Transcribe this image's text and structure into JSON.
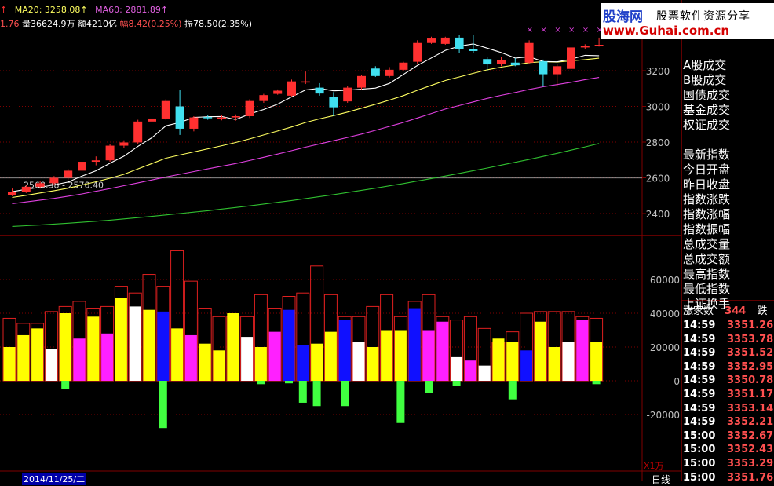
{
  "header": {
    "ma20_label": "MA20: 3258.08↑",
    "ma60_label": "MA60: 2881.89↑",
    "stat_partial": "1.76",
    "volume": "量36624.9万",
    "amount": "额4210亿",
    "change_pct": "幅8.42(0.25%)",
    "amplitude": "振78.50(2.35%)"
  },
  "logo": {
    "name": "股海网",
    "slogan": "股票软件资源分享",
    "url": "www.Guhai.com.cn"
  },
  "price_axis": {
    "labels": [
      "3200",
      "3000",
      "2800",
      "2600",
      "2400"
    ],
    "values": [
      3200,
      3000,
      2800,
      2600,
      2400
    ]
  },
  "volume_axis": {
    "labels": [
      "60000",
      "40000",
      "20000",
      "0",
      "-20000"
    ],
    "values": [
      60000,
      40000,
      20000,
      0,
      -20000
    ]
  },
  "low_marker": {
    "text": "2568.38 - 2570.40",
    "value": 2568.38
  },
  "sidebar": {
    "items_group1": [
      "A股成交",
      "B股成交",
      "国债成交",
      "基金成交",
      "权证成交"
    ],
    "items_group2": [
      "最新指数",
      "今日开盘",
      "昨日收盘",
      "指数涨跌",
      "指数涨幅",
      "指数振幅",
      "总成交量",
      "总成交额",
      "最高指数",
      "最低指数",
      "上证换手"
    ]
  },
  "stats": {
    "rise_label": "涨家数",
    "rise_count": "344",
    "fall_label": "跌"
  },
  "ticks": [
    {
      "time": "14:59",
      "price": "3351.26"
    },
    {
      "time": "14:59",
      "price": "3353.78"
    },
    {
      "time": "14:59",
      "price": "3351.52"
    },
    {
      "time": "14:59",
      "price": "3352.95"
    },
    {
      "time": "14:59",
      "price": "3350.78"
    },
    {
      "time": "14:59",
      "price": "3351.17"
    },
    {
      "time": "14:59",
      "price": "3353.14"
    },
    {
      "time": "14:59",
      "price": "3352.21"
    },
    {
      "time": "15:00",
      "price": "3352.67"
    },
    {
      "time": "15:00",
      "price": "3352.43"
    },
    {
      "time": "15:00",
      "price": "3353.29"
    },
    {
      "time": "15:00",
      "price": "3351.76"
    }
  ],
  "footer": {
    "scale": "X1万",
    "date": "2014/11/25/二",
    "period": "日线"
  },
  "colors": {
    "up": "#ff3030",
    "down": "#40e0f0",
    "ma20": "#ffff60",
    "ma60": "#e040e0",
    "ma120": "#30c030",
    "grid": "#800000"
  },
  "chart_data": {
    "type": "candlestick",
    "candles": [
      {
        "o": 2505,
        "h": 2540,
        "l": 2498,
        "c": 2522
      },
      {
        "o": 2522,
        "h": 2560,
        "l": 2515,
        "c": 2550
      },
      {
        "o": 2550,
        "h": 2580,
        "l": 2540,
        "c": 2570
      },
      {
        "o": 2570,
        "h": 2610,
        "l": 2560,
        "c": 2600
      },
      {
        "o": 2600,
        "h": 2650,
        "l": 2590,
        "c": 2640
      },
      {
        "o": 2640,
        "h": 2700,
        "l": 2625,
        "c": 2690
      },
      {
        "o": 2690,
        "h": 2720,
        "l": 2670,
        "c": 2698
      },
      {
        "o": 2698,
        "h": 2790,
        "l": 2690,
        "c": 2780
      },
      {
        "o": 2780,
        "h": 2810,
        "l": 2765,
        "c": 2798
      },
      {
        "o": 2798,
        "h": 2925,
        "l": 2790,
        "c": 2915
      },
      {
        "o": 2915,
        "h": 2950,
        "l": 2880,
        "c": 2932
      },
      {
        "o": 2932,
        "h": 3040,
        "l": 2925,
        "c": 3030
      },
      {
        "o": 3000,
        "h": 3090,
        "l": 2840,
        "c": 2875
      },
      {
        "o": 2875,
        "h": 2945,
        "l": 2860,
        "c": 2938
      },
      {
        "o": 2940,
        "h": 2950,
        "l": 2925,
        "c": 2935
      },
      {
        "o": 2935,
        "h": 2950,
        "l": 2922,
        "c": 2938
      },
      {
        "o": 2938,
        "h": 2955,
        "l": 2920,
        "c": 2945
      },
      {
        "o": 2945,
        "h": 3040,
        "l": 2935,
        "c": 3030
      },
      {
        "o": 3030,
        "h": 3070,
        "l": 3020,
        "c": 3063
      },
      {
        "o": 3070,
        "h": 3095,
        "l": 3065,
        "c": 3088
      },
      {
        "o": 3060,
        "h": 3150,
        "l": 3055,
        "c": 3140
      },
      {
        "o": 3138,
        "h": 3195,
        "l": 3125,
        "c": 3140
      },
      {
        "o": 3105,
        "h": 3130,
        "l": 3060,
        "c": 3072
      },
      {
        "o": 3052,
        "h": 3080,
        "l": 2945,
        "c": 2995
      },
      {
        "o": 3028,
        "h": 3115,
        "l": 3020,
        "c": 3105
      },
      {
        "o": 3105,
        "h": 3175,
        "l": 3095,
        "c": 3170
      },
      {
        "o": 3212,
        "h": 3225,
        "l": 3165,
        "c": 3170
      },
      {
        "o": 3170,
        "h": 3220,
        "l": 3162,
        "c": 3205
      },
      {
        "o": 3205,
        "h": 3250,
        "l": 3198,
        "c": 3245
      },
      {
        "o": 3250,
        "h": 3370,
        "l": 3240,
        "c": 3355
      },
      {
        "o": 3355,
        "h": 3390,
        "l": 3350,
        "c": 3380
      },
      {
        "o": 3350,
        "h": 3390,
        "l": 3345,
        "c": 3385
      },
      {
        "o": 3385,
        "h": 3400,
        "l": 3300,
        "c": 3320
      },
      {
        "o": 3320,
        "h": 3400,
        "l": 3300,
        "c": 3310
      },
      {
        "o": 3265,
        "h": 3275,
        "l": 3200,
        "c": 3235
      },
      {
        "o": 3238,
        "h": 3275,
        "l": 3225,
        "c": 3258
      },
      {
        "o": 3245,
        "h": 3270,
        "l": 3225,
        "c": 3230
      },
      {
        "o": 3245,
        "h": 3370,
        "l": 3240,
        "c": 3355
      },
      {
        "o": 3252,
        "h": 3262,
        "l": 3110,
        "c": 3180
      },
      {
        "o": 3180,
        "h": 3235,
        "l": 3110,
        "c": 3225
      },
      {
        "o": 3210,
        "h": 3355,
        "l": 3205,
        "c": 3330
      },
      {
        "o": 3330,
        "h": 3348,
        "l": 3320,
        "c": 3340
      },
      {
        "o": 3340,
        "h": 3385,
        "l": 3335,
        "c": 3345
      }
    ],
    "ma20": [
      2490,
      2502,
      2515,
      2528,
      2542,
      2560,
      2578,
      2598,
      2620,
      2650,
      2680,
      2710,
      2728,
      2745,
      2762,
      2780,
      2798,
      2818,
      2840,
      2862,
      2885,
      2910,
      2930,
      2948,
      2968,
      2990,
      3012,
      3035,
      3060,
      3090,
      3118,
      3145,
      3165,
      3185,
      3205,
      3220,
      3232,
      3245,
      3250,
      3248,
      3255,
      3262,
      3270
    ],
    "ma60": [
      2455,
      2465,
      2475,
      2485,
      2497,
      2510,
      2525,
      2540,
      2556,
      2572,
      2588,
      2605,
      2620,
      2635,
      2650,
      2665,
      2680,
      2697,
      2715,
      2733,
      2752,
      2772,
      2790,
      2808,
      2826,
      2845,
      2866,
      2888,
      2910,
      2935,
      2960,
      2985,
      3005,
      3025,
      3045,
      3062,
      3078,
      3095,
      3110,
      3122,
      3135,
      3150,
      3162
    ],
    "ma120": [
      2328,
      2332,
      2336,
      2341,
      2346,
      2351,
      2357,
      2363,
      2370,
      2377,
      2384,
      2392,
      2400,
      2408,
      2416,
      2425,
      2434,
      2443,
      2453,
      2463,
      2473,
      2484,
      2495,
      2506,
      2518,
      2530,
      2542,
      2555,
      2568,
      2582,
      2596,
      2610,
      2625,
      2640,
      2655,
      2671,
      2687,
      2703,
      2720,
      2737,
      2755,
      2773,
      2792
    ],
    "volume_upper": [
      37000,
      34000,
      34000,
      41000,
      44000,
      47000,
      43000,
      44000,
      56000,
      52000,
      63000,
      56000,
      77000,
      59000,
      43000,
      38000,
      38000,
      38000,
      51000,
      43000,
      50000,
      52000,
      68000,
      51000,
      38000,
      38000,
      44000,
      51000,
      38000,
      47000,
      51000,
      38000,
      36000,
      38000,
      31000,
      23000,
      29000,
      40000,
      41000,
      41000,
      41000,
      38000,
      37000
    ],
    "volume_lower": [
      20000,
      27000,
      31000,
      19000,
      40000,
      25000,
      38000,
      28000,
      49000,
      44000,
      42000,
      41000,
      31000,
      27000,
      22000,
      18000,
      40000,
      26000,
      20000,
      29000,
      42000,
      21000,
      22000,
      29000,
      36000,
      23000,
      20000,
      30000,
      30000,
      43000,
      30000,
      35000,
      14000,
      12000,
      9000,
      25000,
      23000,
      18000,
      35000,
      20000,
      23000,
      36000,
      23000
    ],
    "volume_lower_color": [
      "y",
      "y",
      "y",
      "w",
      "y",
      "m",
      "y",
      "m",
      "y",
      "w",
      "y",
      "b",
      "y",
      "m",
      "y",
      "y",
      "y",
      "w",
      "y",
      "m",
      "b",
      "b",
      "y",
      "y",
      "b",
      "w",
      "y",
      "y",
      "y",
      "b",
      "m",
      "m",
      "w",
      "m",
      "w",
      "y",
      "y",
      "b",
      "y",
      "y",
      "w",
      "m",
      "y"
    ],
    "negative": [
      0,
      0,
      0,
      0,
      -5000,
      0,
      0,
      0,
      0,
      0,
      0,
      -28000,
      0,
      0,
      0,
      0,
      0,
      0,
      -2000,
      0,
      -1500,
      -13000,
      -15000,
      0,
      -15000,
      0,
      0,
      0,
      -25000,
      0,
      -7000,
      0,
      -3000,
      0,
      0,
      0,
      -11000,
      0,
      0,
      0,
      0,
      0,
      -2000
    ],
    "hatch_marks": [
      3415,
      3415,
      3415,
      3415,
      3415,
      3415
    ]
  }
}
